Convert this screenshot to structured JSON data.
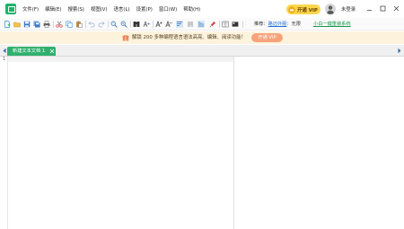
{
  "menu": [
    "文件(F)",
    "编辑(E)",
    "搜索(S)",
    "视图(V)",
    "语言(L)",
    "设置(P)",
    "窗口(W)",
    "帮助(H)"
  ],
  "header": {
    "vip_label": "开通 VIP",
    "login_label": "未登录"
  },
  "toolbar": {
    "icons": [
      "new-file-icon",
      "open-folder-icon",
      "save-icon",
      "save-all-icon",
      "print-icon",
      "cut-icon",
      "copy-icon",
      "paste-icon",
      "undo-icon",
      "redo-icon",
      "find-icon",
      "replace-icon",
      "bookmark-icon",
      "goto-icon",
      "font-increase-icon",
      "font-decrease-icon",
      "word-wrap-icon",
      "show-symbols-icon",
      "indent-guide-icon",
      "pin-icon",
      "split-view-icon",
      "preview-icon"
    ],
    "recommend_prefix": "推荐：",
    "recommend_link": "路迈外服",
    "recommend_suffix": "：无限",
    "promo_link": "小白一键重装系统"
  },
  "banner": {
    "text": "解锁 200 多种编程语言语法高亮、编辑、阅读功能！",
    "button": "开通 VIP"
  },
  "tabs": [
    {
      "label": "新建文本文档 1"
    }
  ],
  "editor": {
    "line_numbers": [
      "1"
    ]
  },
  "colors": {
    "brand_green": "#2fb06d",
    "vip_gold": "#fbd64a",
    "banner_bg": "#fdf3dd",
    "banner_button": "#f6a37c",
    "link_blue": "#1f6fd6"
  }
}
